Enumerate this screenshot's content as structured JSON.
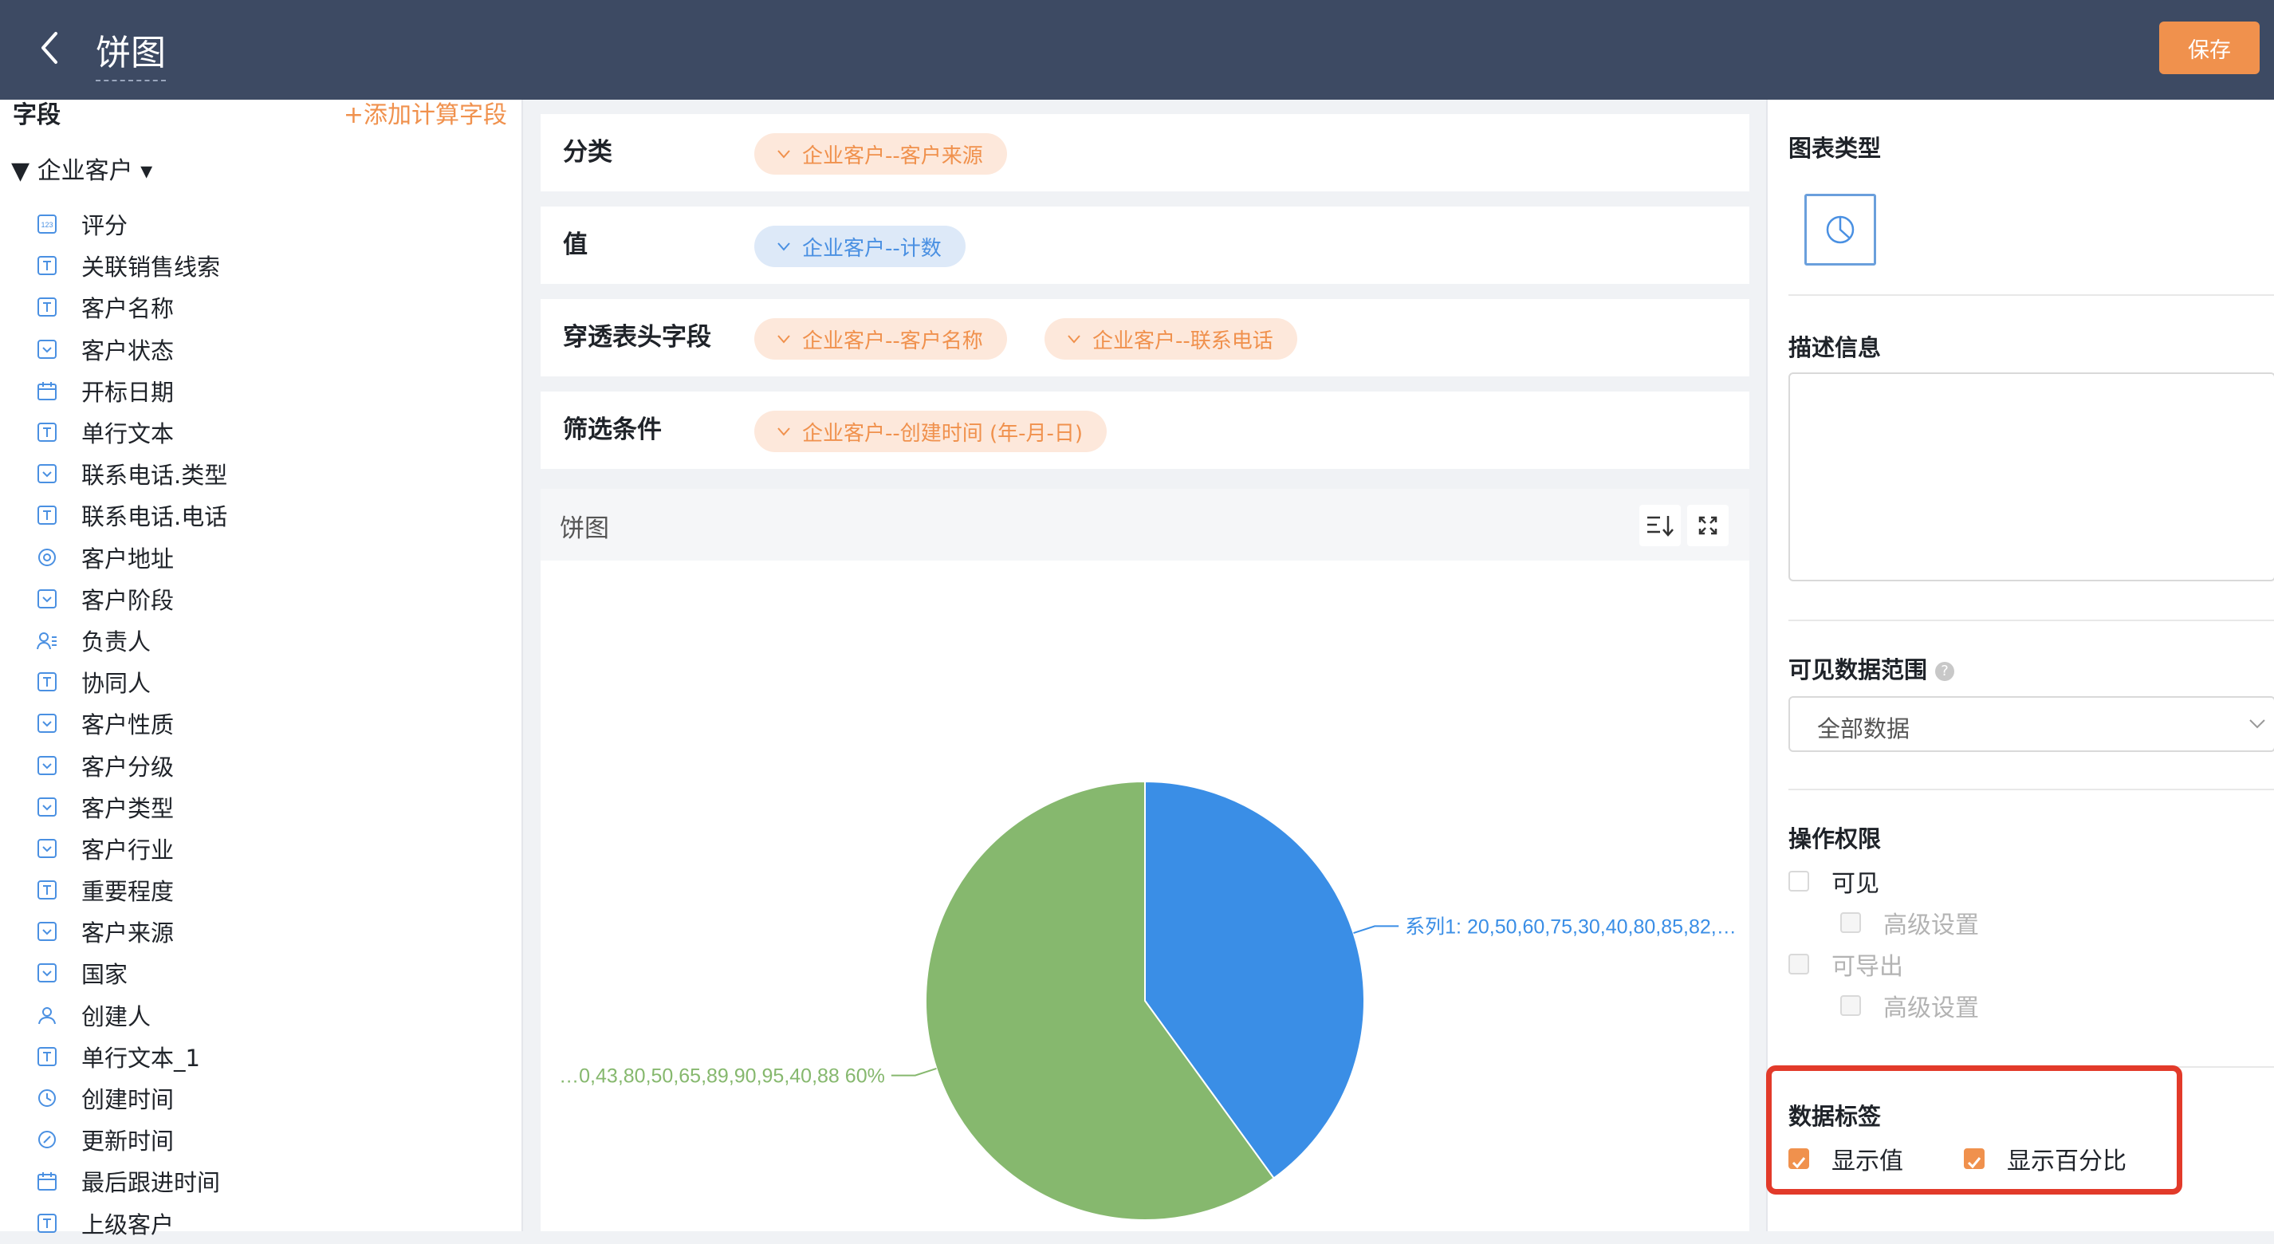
{
  "header": {
    "title": "饼图",
    "save_label": "保存"
  },
  "left": {
    "title": "字段",
    "add_field": "+添加计算字段",
    "group": "▼ 企业客户 ▾",
    "fields": [
      {
        "label": "评分",
        "icon": "number-icon"
      },
      {
        "label": "关联销售线索",
        "icon": "text-icon"
      },
      {
        "label": "客户名称",
        "icon": "text-icon"
      },
      {
        "label": "客户状态",
        "icon": "select-icon"
      },
      {
        "label": "开标日期",
        "icon": "calendar-icon"
      },
      {
        "label": "单行文本",
        "icon": "text-icon"
      },
      {
        "label": "联系电话.类型",
        "icon": "select-icon"
      },
      {
        "label": "联系电话.电话",
        "icon": "text-icon"
      },
      {
        "label": "客户地址",
        "icon": "location-icon"
      },
      {
        "label": "客户阶段",
        "icon": "select-icon"
      },
      {
        "label": "负责人",
        "icon": "user-list-icon"
      },
      {
        "label": "协同人",
        "icon": "text-icon"
      },
      {
        "label": "客户性质",
        "icon": "select-icon"
      },
      {
        "label": "客户分级",
        "icon": "select-icon"
      },
      {
        "label": "客户类型",
        "icon": "select-icon"
      },
      {
        "label": "客户行业",
        "icon": "select-icon"
      },
      {
        "label": "重要程度",
        "icon": "text-icon"
      },
      {
        "label": "客户来源",
        "icon": "select-icon"
      },
      {
        "label": "国家",
        "icon": "select-icon"
      },
      {
        "label": "创建人",
        "icon": "user-icon"
      },
      {
        "label": "单行文本_1",
        "icon": "text-icon"
      },
      {
        "label": "创建时间",
        "icon": "clock-icon"
      },
      {
        "label": "更新时间",
        "icon": "edit-clock-icon"
      },
      {
        "label": "最后跟进时间",
        "icon": "calendar-icon"
      },
      {
        "label": "上级客户",
        "icon": "text-icon"
      }
    ]
  },
  "config": {
    "category": {
      "label": "分类",
      "tags": [
        "企业客户--客户来源"
      ]
    },
    "value": {
      "label": "值",
      "tags": [
        "企业客户--计数"
      ]
    },
    "drill": {
      "label": "穿透表头字段",
      "tags": [
        "企业客户--客户名称",
        "企业客户--联系电话"
      ]
    },
    "filter": {
      "label": "筛选条件",
      "tags": [
        "企业客户--创建时间 (年-月-日)"
      ]
    }
  },
  "chart_panel": {
    "title": "饼图"
  },
  "chart_data": {
    "type": "pie",
    "slices": [
      {
        "label_text": "系列1: 20,50,60,75,30,40,80,85,82,…",
        "percent": 40,
        "color": "#3a8ee6"
      },
      {
        "label_text": "…0,43,80,50,65,89,90,95,40,88 60%",
        "percent": 60,
        "color": "#86b86e"
      }
    ]
  },
  "right": {
    "chart_type_title": "图表类型",
    "chart_type_icon": "pie-chart-icon",
    "desc_title": "描述信息",
    "scope_title": "可见数据范围",
    "scope_help": "?",
    "scope_value": "全部数据",
    "perm_title": "操作权限",
    "visible": "可见",
    "advanced": "高级设置",
    "exportable": "可导出",
    "label_title": "数据标签",
    "show_value": "显示值",
    "show_percent": "显示百分比"
  },
  "colors": {
    "accent": "#f0914d",
    "header": "#3d4a63",
    "pie_blue": "#3a8ee6",
    "pie_green": "#86b86e",
    "highlight": "#e23a2a"
  }
}
